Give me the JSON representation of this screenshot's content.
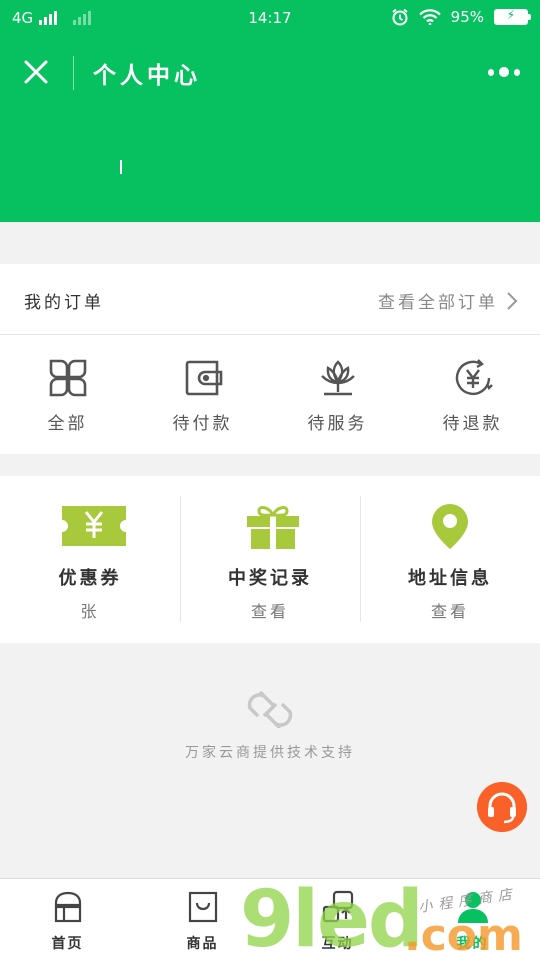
{
  "status_bar": {
    "network": "4G",
    "time": "14:17",
    "battery_percent": "95%"
  },
  "header": {
    "title": "个人中心"
  },
  "orders": {
    "title": "我的订单",
    "view_all": "查看全部订单",
    "tabs": [
      {
        "label": "全部",
        "icon": "grid-icon"
      },
      {
        "label": "待付款",
        "icon": "wallet-icon"
      },
      {
        "label": "待服务",
        "icon": "lotus-icon"
      },
      {
        "label": "待退款",
        "icon": "yen-refund-icon"
      }
    ]
  },
  "services": [
    {
      "name": "优惠券",
      "sub": "张",
      "icon": "coupon-icon"
    },
    {
      "name": "中奖记录",
      "sub": "查看",
      "icon": "gift-icon"
    },
    {
      "name": "地址信息",
      "sub": "查看",
      "icon": "location-pin-icon"
    }
  ],
  "footer": {
    "brand_text": "万家云商提供技术支持"
  },
  "tabbar": [
    {
      "label": "首页",
      "icon": "home-icon",
      "active": false
    },
    {
      "label": "商品",
      "icon": "bag-icon",
      "active": false
    },
    {
      "label": "互动",
      "icon": "interact-icon",
      "active": false
    },
    {
      "label": "我的",
      "icon": "user-icon",
      "active": true
    }
  ],
  "watermark": {
    "main": "9led",
    "suffix": ".com",
    "sub": "小程序商店"
  },
  "colors": {
    "accent": "#07c160",
    "icon_green": "#a8c93c",
    "support_orange": "#fa6128"
  }
}
